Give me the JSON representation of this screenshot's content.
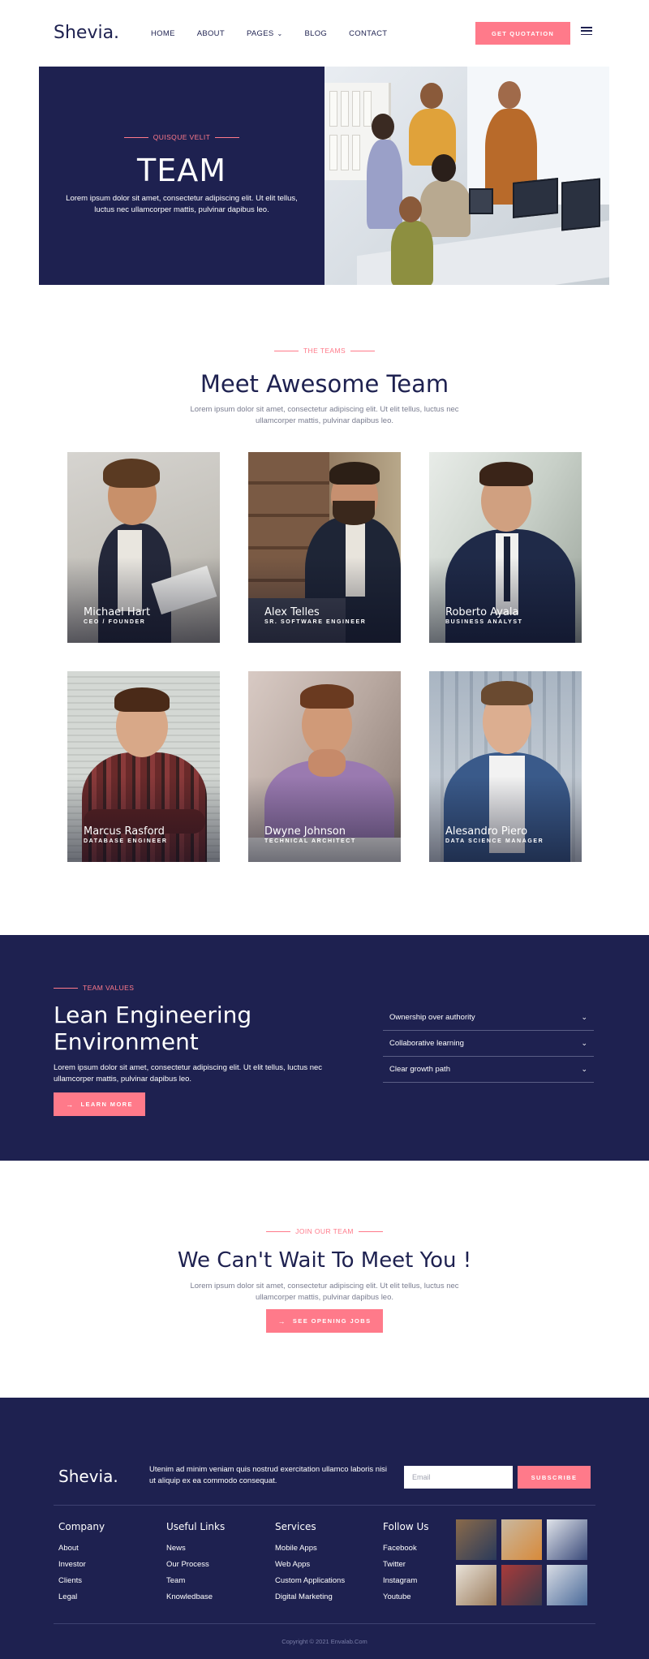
{
  "brand": {
    "logo": "Shevia."
  },
  "nav": {
    "items": [
      {
        "label": "HOME"
      },
      {
        "label": "ABOUT"
      },
      {
        "label": "PAGES",
        "dropdown": true
      },
      {
        "label": "BLOG"
      },
      {
        "label": "CONTACT"
      }
    ],
    "cta_label": "GET QUOTATION"
  },
  "hero": {
    "eyebrow": "QUISQUE VELIT",
    "title": "TEAM",
    "text": "Lorem ipsum dolor sit amet, consectetur adipiscing elit. Ut elit tellus, luctus nec ullamcorper mattis, pulvinar dapibus leo."
  },
  "teams": {
    "eyebrow": "THE TEAMS",
    "title": "Meet Awesome Team",
    "text": "Lorem ipsum dolor sit amet, consectetur adipiscing elit. Ut elit tellus, luctus nec ullamcorper mattis, pulvinar dapibus leo.",
    "members": [
      {
        "name": "Michael Hart",
        "role": "CEO / FOUNDER"
      },
      {
        "name": "Alex Telles",
        "role": "SR. SOFTWARE ENGINEER"
      },
      {
        "name": "Roberto Ayala",
        "role": "BUSINESS ANALYST"
      },
      {
        "name": "Marcus Rasford",
        "role": "DATABASE ENGINEER"
      },
      {
        "name": "Dwyne Johnson",
        "role": "TECHNICAL ARCHITECT"
      },
      {
        "name": "Alesandro Piero",
        "role": "DATA SCIENCE MANAGER"
      }
    ]
  },
  "values": {
    "eyebrow": "TEAM VALUES",
    "title_line1": "Lean Engineering",
    "title_line2": "Environment",
    "text": "Lorem ipsum dolor sit amet, consectetur adipiscing elit. Ut elit tellus, luctus nec ullamcorper mattis, pulvinar dapibus leo.",
    "button": "LEARN MORE",
    "accordion": [
      {
        "label": "Ownership over authority"
      },
      {
        "label": "Collaborative learning"
      },
      {
        "label": "Clear growth path"
      }
    ]
  },
  "join": {
    "eyebrow": "JOIN OUR TEAM",
    "title": "We Can't Wait To Meet You !",
    "text": "Lorem ipsum dolor sit amet, consectetur adipiscing elit. Ut elit tellus, luctus nec ullamcorper mattis, pulvinar dapibus leo.",
    "button": "SEE OPENING JOBS"
  },
  "footer": {
    "logo": "Shevia.",
    "tagline": "Utenim ad minim veniam quis nostrud exercitation ullamco laboris nisi ut aliquip ex ea commodo consequat.",
    "email_placeholder": "Email",
    "subscribe": "SUBSCRIBE",
    "columns": [
      {
        "title": "Company",
        "links": [
          "About",
          "Investor",
          "Clients",
          "Legal"
        ]
      },
      {
        "title": "Useful Links",
        "links": [
          "News",
          "Our Process",
          "Team",
          "Knowledbase"
        ]
      },
      {
        "title": "Services",
        "links": [
          "Mobile Apps",
          "Web Apps",
          "Custom Applications",
          "Digital Marketing"
        ]
      },
      {
        "title": "Follow Us",
        "links": [
          "Facebook",
          "Twitter",
          "Instagram",
          "Youtube"
        ]
      }
    ],
    "copyright": "Copyright © 2021 Envalab.Com"
  },
  "colors": {
    "navy": "#1e2150",
    "accent": "#ff7a8a",
    "white": "#ffffff"
  }
}
